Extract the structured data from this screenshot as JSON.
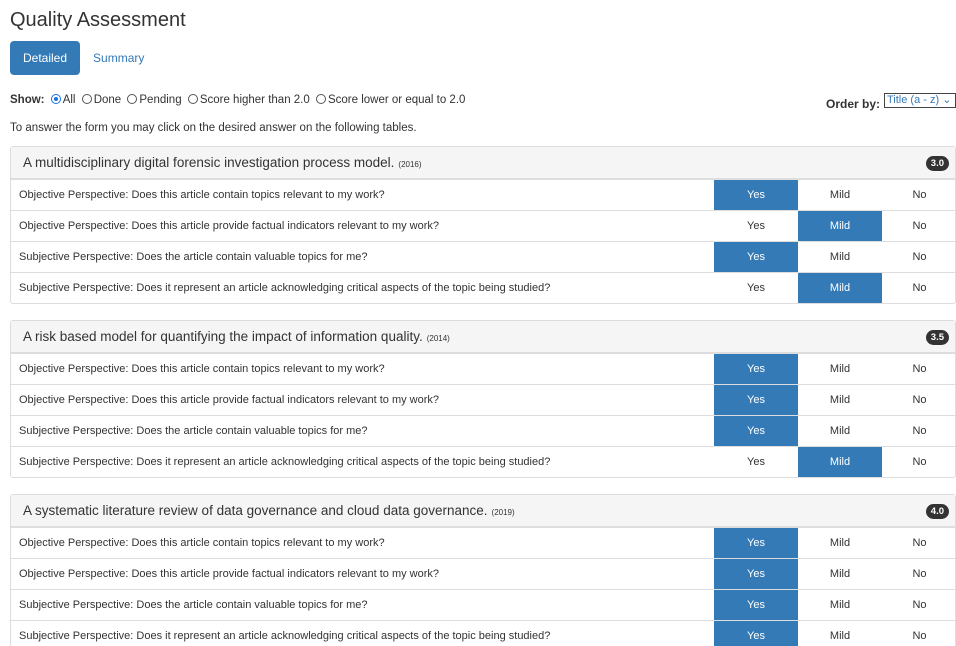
{
  "page_title": "Quality Assessment",
  "tabs": [
    {
      "label": "Detailed",
      "active": true
    },
    {
      "label": "Summary",
      "active": false
    }
  ],
  "filter": {
    "show_label": "Show:",
    "options": [
      {
        "label": "All",
        "checked": true
      },
      {
        "label": "Done",
        "checked": false
      },
      {
        "label": "Pending",
        "checked": false
      },
      {
        "label": "Score higher than 2.0",
        "checked": false
      },
      {
        "label": "Score lower or equal to 2.0",
        "checked": false
      }
    ],
    "order_label": "Order by:",
    "order_value": "Title (a - z)"
  },
  "instruction": "To answer the form you may click on the desired answer on the following tables.",
  "answer_labels": {
    "yes": "Yes",
    "mild": "Mild",
    "no": "No"
  },
  "accent_color": "#337ab7",
  "articles": [
    {
      "title": "A multidisciplinary digital forensic investigation process model.",
      "year": "(2016)",
      "score": "3.0",
      "questions": [
        {
          "text": "Objective Perspective: Does this article contain topics relevant to my work?",
          "selected": "yes"
        },
        {
          "text": "Objective Perspective: Does this article provide factual indicators relevant to my work?",
          "selected": "mild"
        },
        {
          "text": "Subjective Perspective: Does the article contain valuable topics for me?",
          "selected": "yes"
        },
        {
          "text": "Subjective Perspective: Does it represent an article acknowledging critical aspects of the topic being studied?",
          "selected": "mild"
        }
      ]
    },
    {
      "title": "A risk based model for quantifying the impact of information quality.",
      "year": "(2014)",
      "score": "3.5",
      "questions": [
        {
          "text": "Objective Perspective: Does this article contain topics relevant to my work?",
          "selected": "yes"
        },
        {
          "text": "Objective Perspective: Does this article provide factual indicators relevant to my work?",
          "selected": "yes"
        },
        {
          "text": "Subjective Perspective: Does the article contain valuable topics for me?",
          "selected": "yes"
        },
        {
          "text": "Subjective Perspective: Does it represent an article acknowledging critical aspects of the topic being studied?",
          "selected": "mild"
        }
      ]
    },
    {
      "title": "A systematic literature review of data governance and cloud data governance.",
      "year": "(2019)",
      "score": "4.0",
      "questions": [
        {
          "text": "Objective Perspective: Does this article contain topics relevant to my work?",
          "selected": "yes"
        },
        {
          "text": "Objective Perspective: Does this article provide factual indicators relevant to my work?",
          "selected": "yes"
        },
        {
          "text": "Subjective Perspective: Does the article contain valuable topics for me?",
          "selected": "yes"
        },
        {
          "text": "Subjective Perspective: Does it represent an article acknowledging critical aspects of the topic being studied?",
          "selected": "yes"
        }
      ]
    }
  ]
}
